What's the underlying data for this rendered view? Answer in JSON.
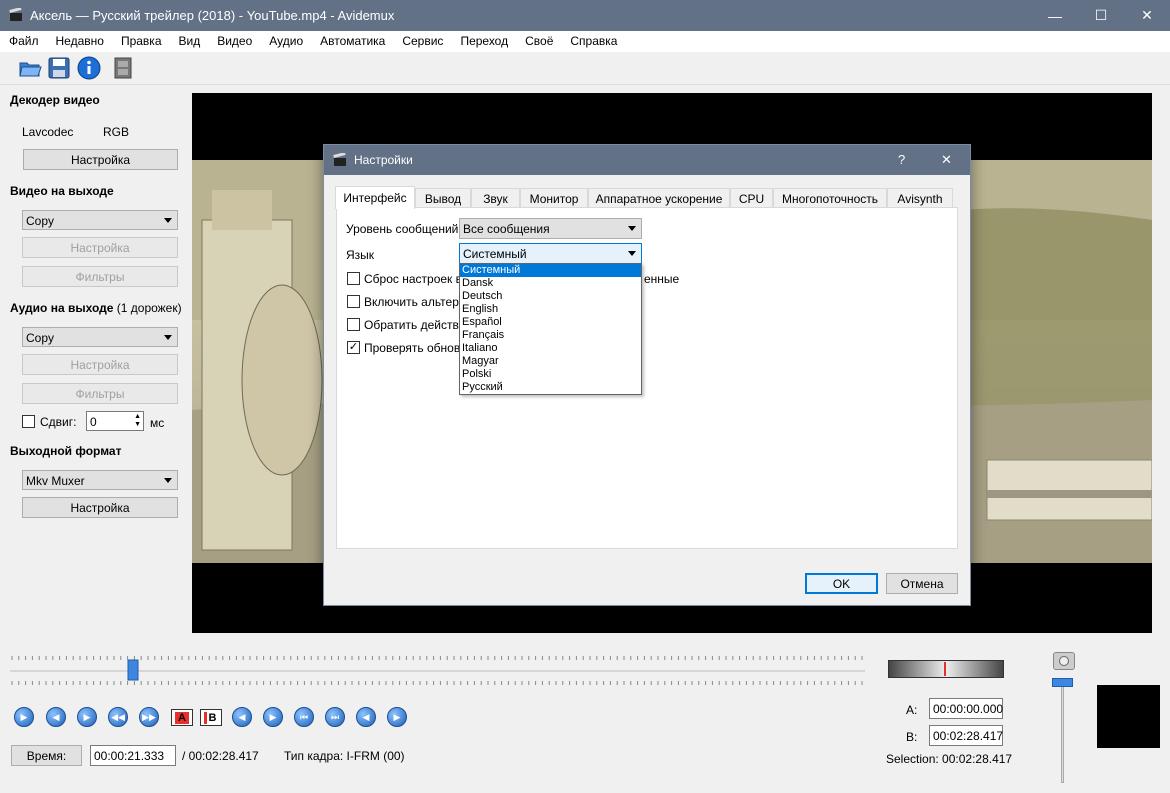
{
  "window": {
    "title": "Аксель — Русский трейлер (2018) - YouTube.mp4 - Avidemux",
    "minimize": "—",
    "maximize": "☐",
    "close": "✕"
  },
  "menu": [
    "Файл",
    "Недавно",
    "Правка",
    "Вид",
    "Видео",
    "Аудио",
    "Автоматика",
    "Сервис",
    "Переход",
    "Своё",
    "Справка"
  ],
  "toolbar": {
    "icons": [
      "open-folder-icon",
      "save-disk-icon",
      "info-icon",
      "filmstrip-icon"
    ]
  },
  "left_panel": {
    "video_decoder": {
      "header": "Декодер видео",
      "codec": "Lavcodec",
      "colorspace": "RGB",
      "config_button": "Настройка"
    },
    "video_output": {
      "header": "Видео на выходе",
      "codec": "Copy",
      "config_button": "Настройка",
      "filters_button": "Фильтры"
    },
    "audio_output": {
      "header": "Аудио на выходе",
      "tracks": "(1 дорожек)",
      "codec": "Copy",
      "config_button": "Настройка",
      "filters_button": "Фильтры",
      "shift_label": "Сдвиг:",
      "shift_value": "0",
      "shift_unit": "мс"
    },
    "output_format": {
      "header": "Выходной формат",
      "muxer": "Mkv Muxer",
      "config_button": "Настройка"
    }
  },
  "dialog": {
    "title": "Настройки",
    "help": "?",
    "close": "✕",
    "tabs": [
      "Интерфейс",
      "Вывод",
      "Звук",
      "Монитор",
      "Аппаратное ускорение",
      "CPU",
      "Многопоточность",
      "Avisynth"
    ],
    "active_tab": "Интерфейс",
    "message_level_label": "Уровень сообщений:",
    "message_level_value": "Все сообщения",
    "language_label": "Язык",
    "language_value": "Системный",
    "language_options": [
      "Системный",
      "Dansk",
      "Deutsch",
      "English",
      "Español",
      "Français",
      "Italiano",
      "Magyar",
      "Polski",
      "Русский"
    ],
    "checkboxes": [
      {
        "label": "Сброс настроек вы",
        "suffix": "енные",
        "checked": false
      },
      {
        "label": "Включить альтерн",
        "checked": false
      },
      {
        "label": "Обратить действи",
        "checked": false
      },
      {
        "label": "Проверять обновл",
        "checked": true
      }
    ],
    "ok": "OK",
    "cancel": "Отмена"
  },
  "bottom": {
    "marker_a": "A",
    "marker_b": "B",
    "time_button": "Время:",
    "current_time": "00:00:21.333",
    "total_time": "/ 00:02:28.417",
    "frame_type": "Тип кадра:  I-FRM (00)",
    "a_label": "A:",
    "a_value": "00:00:00.000",
    "b_label": "B:",
    "b_value": "00:02:28.417",
    "selection": "Selection: 00:02:28.417",
    "playhead_fraction": 0.144
  },
  "colors": {
    "titlebar": "#627186",
    "accent": "#0078d7",
    "marker_red": "#e8302a"
  }
}
